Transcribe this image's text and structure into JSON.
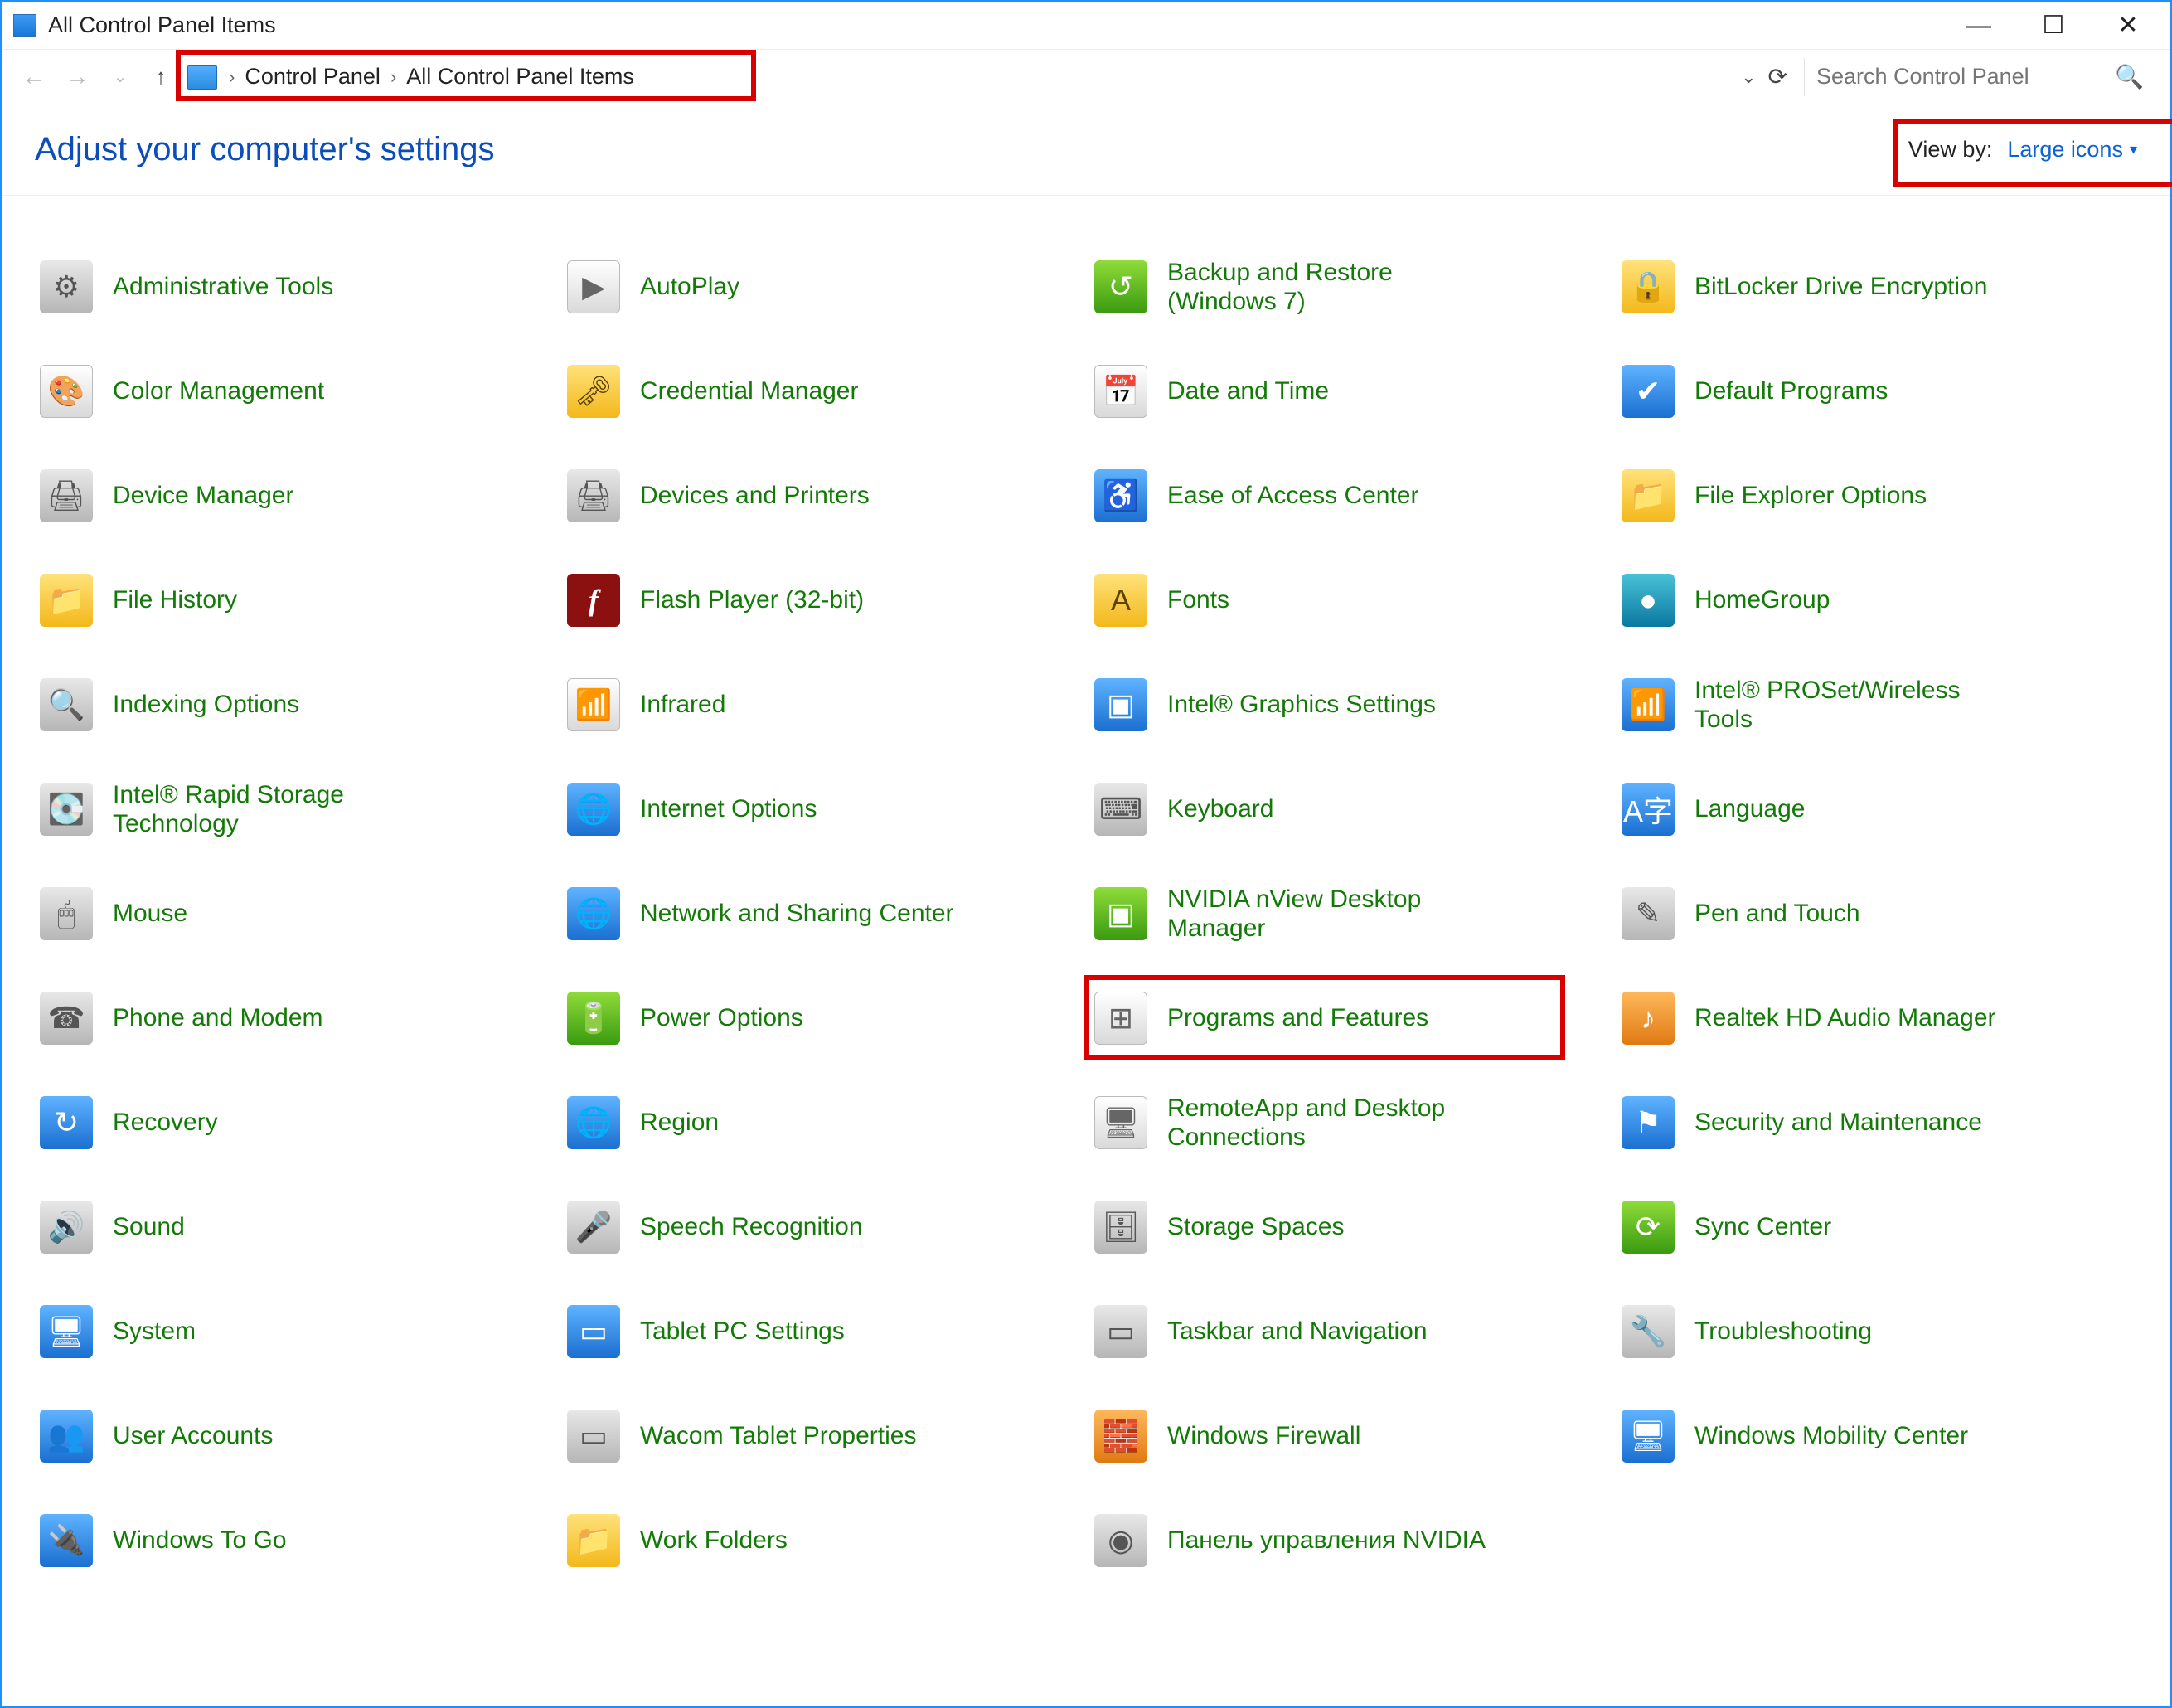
{
  "window": {
    "title": "All Control Panel Items"
  },
  "breadcrumb": {
    "parts": [
      "Control Panel",
      "All Control Panel Items"
    ]
  },
  "search": {
    "placeholder": "Search Control Panel"
  },
  "header": {
    "title": "Adjust your computer's settings",
    "viewby_label": "View by:",
    "viewby_value": "Large icons"
  },
  "items": [
    {
      "label": "Administrative Tools",
      "icon": "admin",
      "cls": "ic-grey"
    },
    {
      "label": "AutoPlay",
      "icon": "autoplay",
      "cls": "ic-plain"
    },
    {
      "label": "Backup and Restore (Windows 7)",
      "icon": "backup",
      "cls": "ic-green"
    },
    {
      "label": "BitLocker Drive Encryption",
      "icon": "bitlocker",
      "cls": "ic-yellow"
    },
    {
      "label": "Color Management",
      "icon": "color",
      "cls": "ic-plain"
    },
    {
      "label": "Credential Manager",
      "icon": "cred",
      "cls": "ic-yellow"
    },
    {
      "label": "Date and Time",
      "icon": "date",
      "cls": "ic-plain"
    },
    {
      "label": "Default Programs",
      "icon": "default",
      "cls": "ic-blue"
    },
    {
      "label": "Device Manager",
      "icon": "devmgr",
      "cls": "ic-grey"
    },
    {
      "label": "Devices and Printers",
      "icon": "devprint",
      "cls": "ic-grey"
    },
    {
      "label": "Ease of Access Center",
      "icon": "ease",
      "cls": "ic-blue"
    },
    {
      "label": "File Explorer Options",
      "icon": "explorer",
      "cls": "ic-yellow"
    },
    {
      "label": "File History",
      "icon": "filehist",
      "cls": "ic-yellow"
    },
    {
      "label": "Flash Player (32-bit)",
      "icon": "flash",
      "cls": "flash"
    },
    {
      "label": "Fonts",
      "icon": "fonts",
      "cls": "ic-yellow"
    },
    {
      "label": "HomeGroup",
      "icon": "homegroup",
      "cls": "ic-teal"
    },
    {
      "label": "Indexing Options",
      "icon": "indexing",
      "cls": "ic-grey"
    },
    {
      "label": "Infrared",
      "icon": "infrared",
      "cls": "ic-plain"
    },
    {
      "label": "Intel® Graphics Settings",
      "icon": "intelgfx",
      "cls": "ic-blue"
    },
    {
      "label": "Intel® PROSet/Wireless Tools",
      "icon": "intelwifi",
      "cls": "ic-blue"
    },
    {
      "label": "Intel® Rapid Storage Technology",
      "icon": "intelrst",
      "cls": "ic-grey"
    },
    {
      "label": "Internet Options",
      "icon": "inet",
      "cls": "ic-blue"
    },
    {
      "label": "Keyboard",
      "icon": "keyboard",
      "cls": "ic-grey"
    },
    {
      "label": "Language",
      "icon": "language",
      "cls": "ic-blue"
    },
    {
      "label": "Mouse",
      "icon": "mouse",
      "cls": "ic-grey"
    },
    {
      "label": "Network and Sharing Center",
      "icon": "network",
      "cls": "ic-blue"
    },
    {
      "label": "NVIDIA nView Desktop Manager",
      "icon": "nvidiav",
      "cls": "ic-green"
    },
    {
      "label": "Pen and Touch",
      "icon": "pen",
      "cls": "ic-grey"
    },
    {
      "label": "Phone and Modem",
      "icon": "phone",
      "cls": "ic-grey"
    },
    {
      "label": "Power Options",
      "icon": "power",
      "cls": "ic-green"
    },
    {
      "label": "Programs and Features",
      "icon": "programs",
      "cls": "ic-plain",
      "highlight": true
    },
    {
      "label": "Realtek HD Audio Manager",
      "icon": "realtek",
      "cls": "ic-orange"
    },
    {
      "label": "Recovery",
      "icon": "recovery",
      "cls": "ic-blue"
    },
    {
      "label": "Region",
      "icon": "region",
      "cls": "ic-blue"
    },
    {
      "label": "RemoteApp and Desktop Connections",
      "icon": "remote",
      "cls": "ic-plain"
    },
    {
      "label": "Security and Maintenance",
      "icon": "security",
      "cls": "ic-blue"
    },
    {
      "label": "Sound",
      "icon": "sound",
      "cls": "ic-grey"
    },
    {
      "label": "Speech Recognition",
      "icon": "speech",
      "cls": "ic-grey"
    },
    {
      "label": "Storage Spaces",
      "icon": "storage",
      "cls": "ic-grey"
    },
    {
      "label": "Sync Center",
      "icon": "sync",
      "cls": "ic-green"
    },
    {
      "label": "System",
      "icon": "system",
      "cls": "ic-blue"
    },
    {
      "label": "Tablet PC Settings",
      "icon": "tablet",
      "cls": "ic-blue"
    },
    {
      "label": "Taskbar and Navigation",
      "icon": "taskbar",
      "cls": "ic-grey"
    },
    {
      "label": "Troubleshooting",
      "icon": "trouble",
      "cls": "ic-grey"
    },
    {
      "label": "User Accounts",
      "icon": "users",
      "cls": "ic-blue"
    },
    {
      "label": "Wacom Tablet Properties",
      "icon": "wacom",
      "cls": "ic-grey"
    },
    {
      "label": "Windows Firewall",
      "icon": "firewall",
      "cls": "ic-orange"
    },
    {
      "label": "Windows Mobility Center",
      "icon": "mobility",
      "cls": "ic-blue"
    },
    {
      "label": "Windows To Go",
      "icon": "wintogo",
      "cls": "ic-blue"
    },
    {
      "label": "Work Folders",
      "icon": "workfold",
      "cls": "ic-yellow"
    },
    {
      "label": "Панель управления NVIDIA",
      "icon": "nvidia",
      "cls": "ic-grey"
    }
  ],
  "icon_glyph": {
    "admin": "⚙",
    "autoplay": "▶",
    "backup": "↺",
    "bitlocker": "🔒",
    "color": "🎨",
    "cred": "🗝",
    "date": "📅",
    "default": "✔",
    "devmgr": "🖨",
    "devprint": "🖨",
    "ease": "♿",
    "explorer": "📁",
    "filehist": "📁",
    "flash": "f",
    "fonts": "A",
    "homegroup": "●",
    "indexing": "🔍",
    "infrared": "📶",
    "intelgfx": "▣",
    "intelwifi": "📶",
    "intelrst": "💽",
    "inet": "🌐",
    "keyboard": "⌨",
    "language": "A字",
    "mouse": "🖱",
    "network": "🌐",
    "nvidiav": "▣",
    "pen": "✎",
    "phone": "☎",
    "power": "🔋",
    "programs": "⊞",
    "realtek": "♪",
    "recovery": "↻",
    "region": "🌐",
    "remote": "🖥",
    "security": "⚑",
    "sound": "🔊",
    "speech": "🎤",
    "storage": "🗄",
    "sync": "⟳",
    "system": "🖥",
    "tablet": "▭",
    "taskbar": "▭",
    "trouble": "🔧",
    "users": "👥",
    "wacom": "▭",
    "firewall": "🧱",
    "mobility": "🖥",
    "wintogo": "🔌",
    "workfold": "📁",
    "nvidia": "◉"
  }
}
